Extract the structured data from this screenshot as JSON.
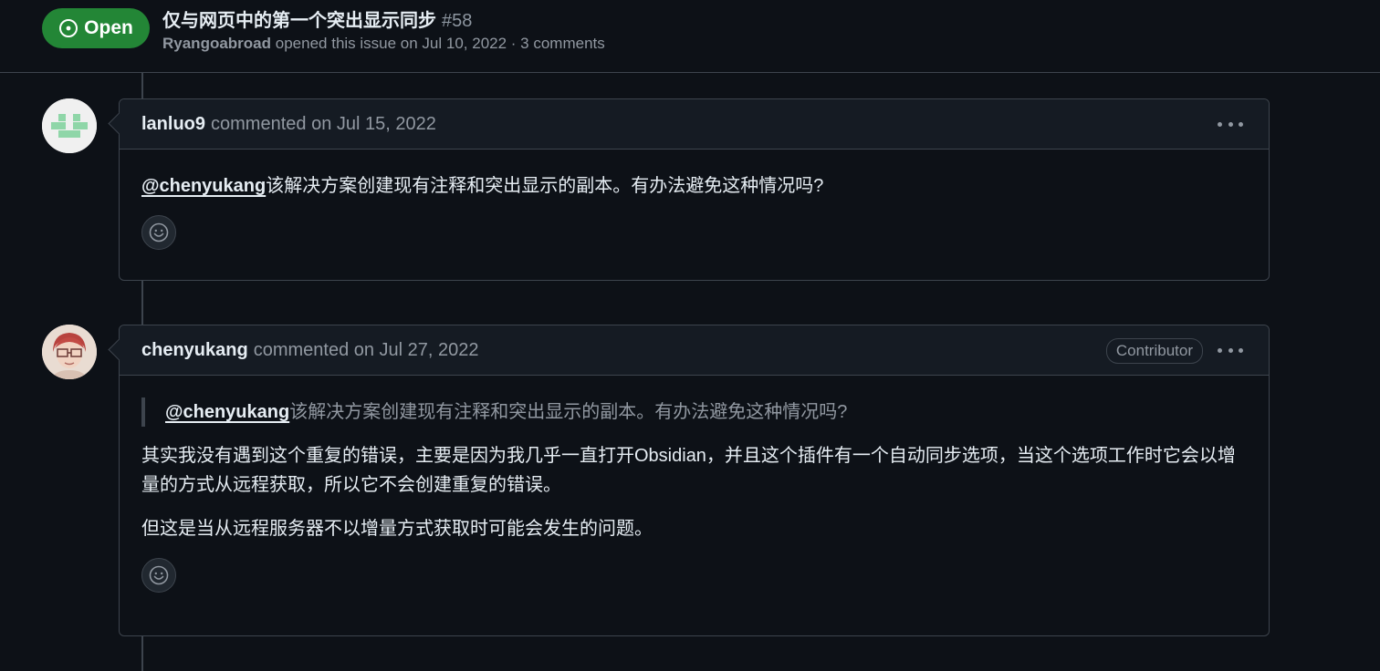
{
  "issue": {
    "state": "Open",
    "title": "仅与网页中的第一个突出显示同步",
    "number": "#58",
    "author": "Ryangoabroad",
    "meta": "opened this issue on Jul 10, 2022 · 3 comments"
  },
  "comments": [
    {
      "author": "lanluo9",
      "meta": "commented on Jul 15, 2022",
      "mention": "@chenyukang",
      "body": "该解决方案创建现有注释和突出显示的副本。有办法避免这种情况吗?"
    },
    {
      "author": "chenyukang",
      "meta": "commented on Jul 27, 2022",
      "badge": "Contributor",
      "quote_mention": "@chenyukang",
      "quote_text": "该解决方案创建现有注释和突出显示的副本。有办法避免这种情况吗?",
      "para1": "其实我没有遇到这个重复的错误，主要是因为我几乎一直打开Obsidian，并且这个插件有一个自动同步选项，当这个选项工作时它会以增量的方式从远程获取，所以它不会创建重复的错误。",
      "para2": "但这是当从远程服务器不以增量方式获取时可能会发生的问题。"
    }
  ],
  "icons": {
    "state": "issue-opened-icon",
    "more": "kebab-horizontal-icon",
    "reaction": "smiley-icon"
  }
}
